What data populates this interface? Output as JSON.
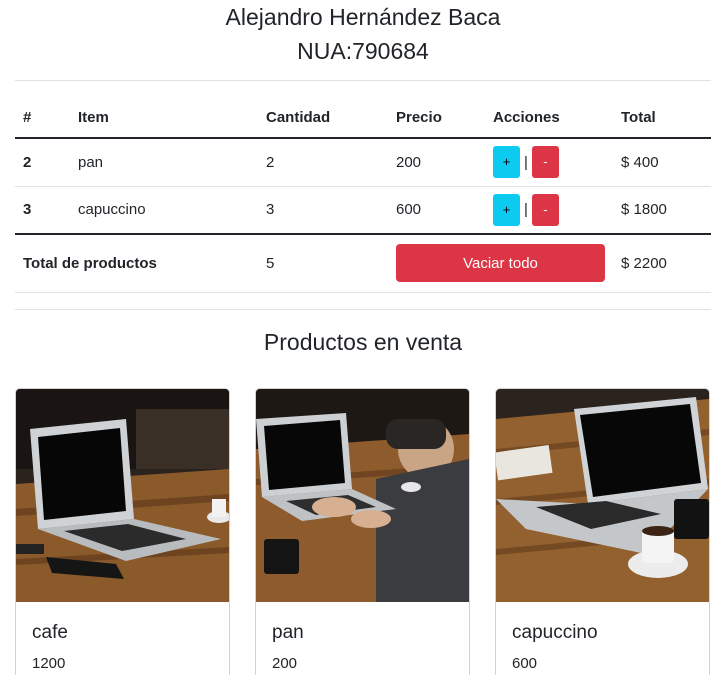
{
  "header": {
    "name": "Alejandro Hernández Baca",
    "nua": "NUA:790684"
  },
  "cart": {
    "columns": [
      "#",
      "Item",
      "Cantidad",
      "Precio",
      "Acciones",
      "Total"
    ],
    "rows": [
      {
        "id": "2",
        "item": "pan",
        "cantidad": "2",
        "precio": "200",
        "total": "$ 400"
      },
      {
        "id": "3",
        "item": "capuccino",
        "cantidad": "3",
        "precio": "600",
        "total": "$ 1800"
      }
    ],
    "plus_label": "+",
    "minus_label": "-",
    "separator": "|",
    "footer": {
      "label": "Total de productos",
      "count": "5",
      "empty_button": "Vaciar todo",
      "total": "$ 2200"
    }
  },
  "products": {
    "title": "Productos en venta",
    "items": [
      {
        "name": "cafe",
        "price": "1200"
      },
      {
        "name": "pan",
        "price": "200"
      },
      {
        "name": "capuccino",
        "price": "600"
      }
    ]
  },
  "colors": {
    "info": "#0dcaf0",
    "danger": "#dc3545"
  }
}
